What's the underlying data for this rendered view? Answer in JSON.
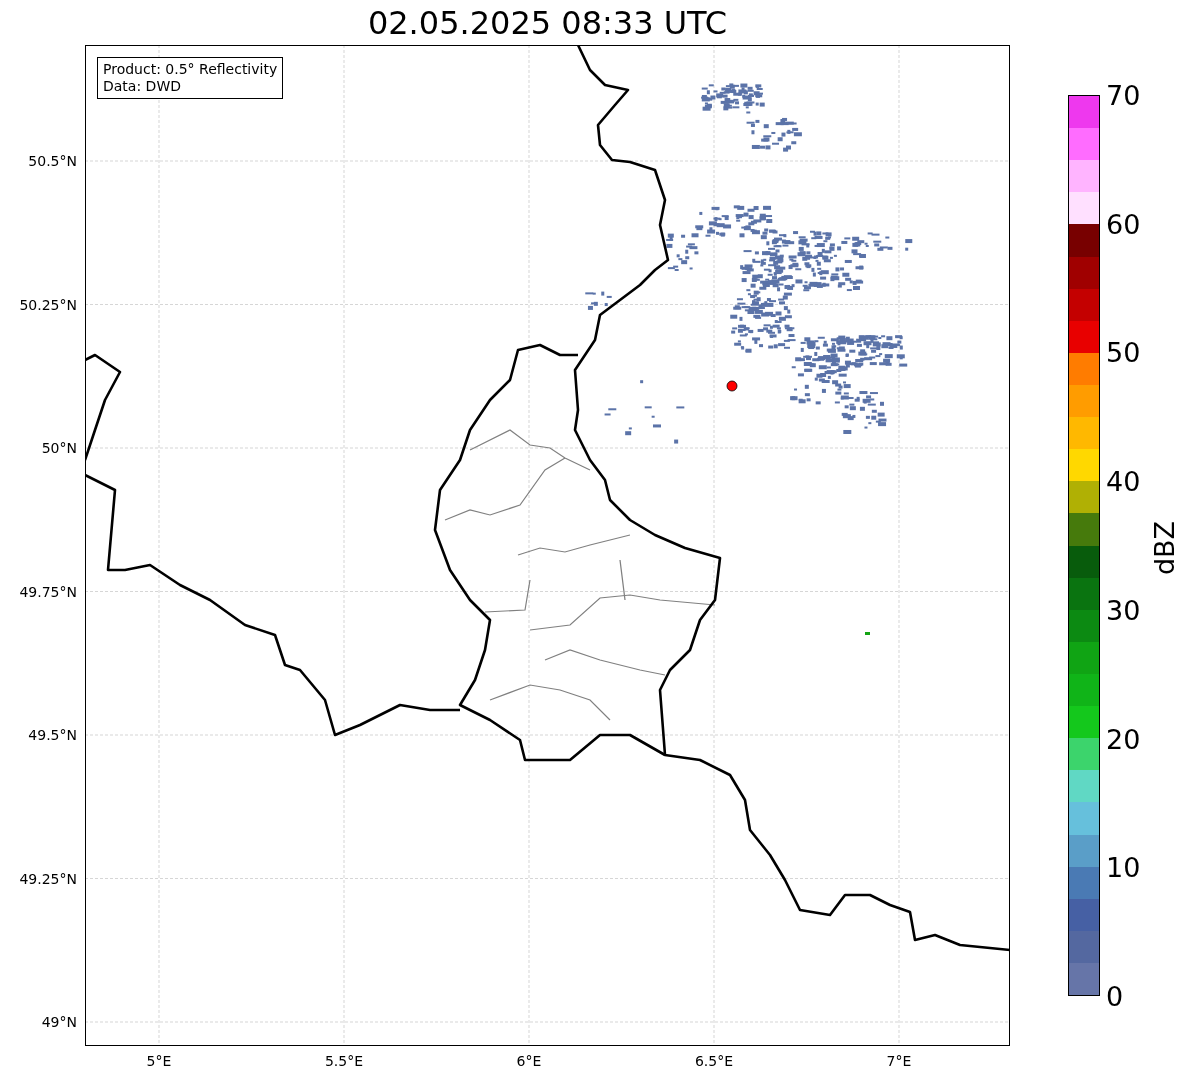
{
  "title": "02.05.2025 08:33 UTC",
  "info_box": {
    "lines": [
      "Product: 0.5° Reflectivity",
      "Data: DWD"
    ]
  },
  "map": {
    "latitude_labels": [
      "50.5°N",
      "50.25°N",
      "50°N",
      "49.75°N",
      "49.5°N",
      "49.25°N",
      "49°N"
    ],
    "longitude_labels": [
      "5°E",
      "5.5°E",
      "6°E",
      "6.5°E",
      "7°E"
    ]
  },
  "colorbar": {
    "label": "dBZ",
    "ticks": [
      "70",
      "60",
      "50",
      "40",
      "30",
      "20",
      "10",
      "0"
    ],
    "levels": [
      {
        "color": "#ee38ee"
      },
      {
        "color": "#ff6cff"
      },
      {
        "color": "#ffb4ff"
      },
      {
        "color": "#ffe0ff"
      },
      {
        "color": "#780000"
      },
      {
        "color": "#a00000"
      },
      {
        "color": "#c40000"
      },
      {
        "color": "#e80000"
      },
      {
        "color": "#ff7c00"
      },
      {
        "color": "#ff9c00"
      },
      {
        "color": "#ffb800"
      },
      {
        "color": "#ffd800"
      },
      {
        "color": "#b0b004"
      },
      {
        "color": "#467a0c"
      },
      {
        "color": "#085c0c"
      },
      {
        "color": "#0a7410"
      },
      {
        "color": "#0c8a12"
      },
      {
        "color": "#10a414"
      },
      {
        "color": "#10b418"
      },
      {
        "color": "#14c81c"
      },
      {
        "color": "#3cd46c"
      },
      {
        "color": "#60d8c4"
      },
      {
        "color": "#66c0dc"
      },
      {
        "color": "#5a9ec8"
      },
      {
        "color": "#4a7ab4"
      },
      {
        "color": "#4660a4"
      },
      {
        "color": "#5468a0"
      },
      {
        "color": "#6675a8"
      }
    ]
  }
}
